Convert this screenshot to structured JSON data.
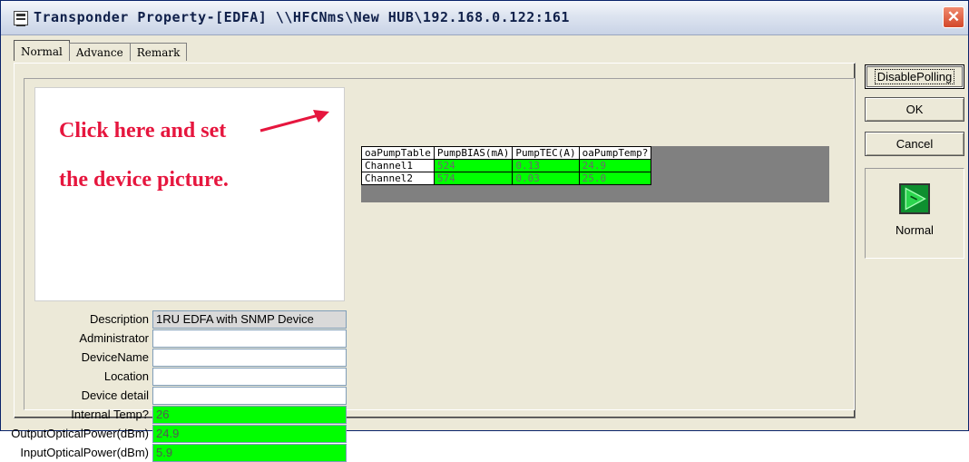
{
  "window": {
    "title": "Transponder Property-[EDFA] \\\\HFCNms\\New HUB\\192.168.0.122:161"
  },
  "tabs": [
    {
      "label": "Normal",
      "active": true
    },
    {
      "label": "Advance",
      "active": false
    },
    {
      "label": "Remark",
      "active": false
    }
  ],
  "picture": {
    "line1": "Click here and set",
    "line2": "the device picture."
  },
  "fields": [
    {
      "label": "Description",
      "value": "1RU EDFA with SNMP Device",
      "style": "ro"
    },
    {
      "label": "Administrator",
      "value": "",
      "style": ""
    },
    {
      "label": "DeviceName",
      "value": "",
      "style": ""
    },
    {
      "label": "Location",
      "value": "",
      "style": ""
    },
    {
      "label": "Device detail",
      "value": "",
      "style": ""
    },
    {
      "label": "Internal Temp?",
      "value": "26",
      "style": "green"
    },
    {
      "label": "OutputOpticalPower(dBm)",
      "value": "24.9",
      "style": "green"
    },
    {
      "label": "InputOpticalPower(dBm)",
      "value": "5.9",
      "style": "green"
    }
  ],
  "pump_table": {
    "headers": [
      "oaPumpTable",
      "PumpBIAS(mA)",
      "PumpTEC(A)",
      "oaPumpTemp?"
    ],
    "rows": [
      {
        "name": "Channel1",
        "cells": [
          "524",
          "0.13",
          "24.9"
        ]
      },
      {
        "name": "Channel2",
        "cells": [
          "574",
          "0.03",
          "25.0"
        ]
      }
    ]
  },
  "side": {
    "disable_polling": "DisablePolling",
    "ok": "OK",
    "cancel": "Cancel",
    "status_label": "Normal"
  },
  "colors": {
    "value_green": "#00ff00",
    "annotation_red": "#e6163e"
  }
}
